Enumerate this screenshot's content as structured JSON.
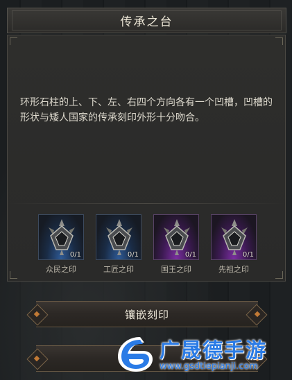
{
  "dialog": {
    "title": "传承之台",
    "description": "环形石柱的上、下、左、右四个方向各有一个凹槽，凹槽的形状与矮人国家的传承刻印外形十分吻合。"
  },
  "seals": [
    {
      "name": "众民之印",
      "count": "0/1",
      "rarity_color": "#2e5a96",
      "icon": "seal-amulet-icon"
    },
    {
      "name": "工匠之印",
      "count": "0/1",
      "rarity_color": "#2e5a96",
      "icon": "seal-amulet-icon"
    },
    {
      "name": "国王之印",
      "count": "0/1",
      "rarity_color": "#7a2ea0",
      "icon": "seal-amulet-icon"
    },
    {
      "name": "先祖之印",
      "count": "0/1",
      "rarity_color": "#7a2ea0",
      "icon": "seal-amulet-icon"
    }
  ],
  "buttons": {
    "inlay_label": "镶嵌刻印"
  },
  "watermark": {
    "name": "广晟德手游",
    "url": "www.gsdtiepianji.com",
    "color": "#2a7be6"
  }
}
